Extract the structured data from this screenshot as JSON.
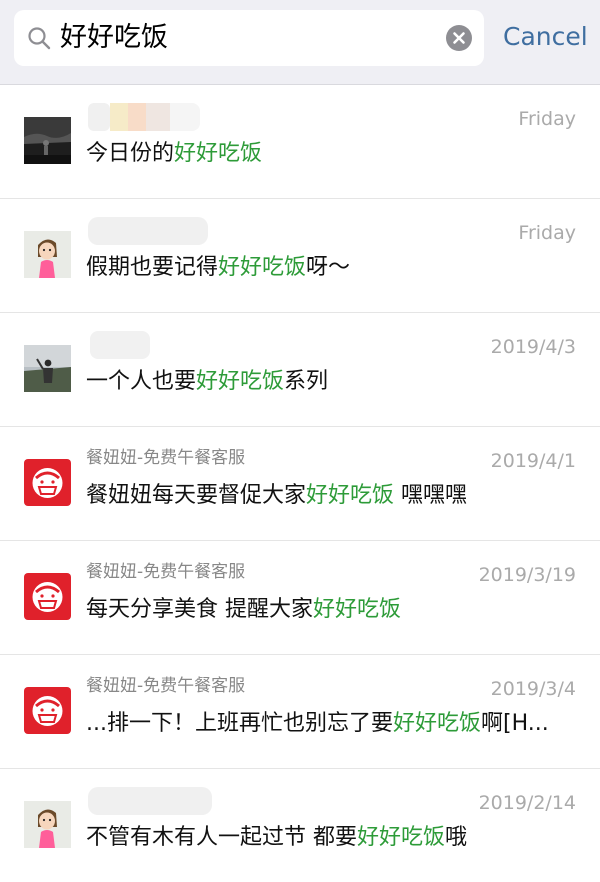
{
  "search": {
    "query": "好好吃饭",
    "cancel_label": "Cancel"
  },
  "results": [
    {
      "name": "",
      "date": "Friday",
      "pre": "今日份的",
      "hl": "好好吃饭",
      "post": "",
      "avatar": "dark-photo"
    },
    {
      "name": "",
      "date": "Friday",
      "pre": "假期也要记得",
      "hl": "好好吃饭",
      "post": "呀～",
      "avatar": "girl-cartoon"
    },
    {
      "name": "",
      "date": "2019/4/3",
      "pre": "一个人也要",
      "hl": "好好吃饭",
      "post": "系列",
      "avatar": "person-photo"
    },
    {
      "name": "餐妞妞-免费午餐客服",
      "date": "2019/4/1",
      "pre": "餐妞妞每天要督促大家",
      "hl": "好好吃饭",
      "post": " 嘿嘿嘿",
      "avatar": "red-logo"
    },
    {
      "name": "餐妞妞-免费午餐客服",
      "date": "2019/3/19",
      "pre": "每天分享美食  提醒大家",
      "hl": "好好吃饭",
      "post": "",
      "avatar": "red-logo"
    },
    {
      "name": "餐妞妞-免费午餐客服",
      "date": "2019/3/4",
      "pre": "...排一下！上班再忙也别忘了要",
      "hl": "好好吃饭",
      "post": "啊[H...",
      "avatar": "red-logo"
    },
    {
      "name": "",
      "date": "2019/2/14",
      "pre": "不管有木有人一起过节 都要",
      "hl": "好好吃饭",
      "post": "哦",
      "avatar": "girl-cartoon"
    }
  ],
  "colors": {
    "highlight": "#2d9b38",
    "cancel": "#3f6ea0",
    "header_bg": "#efeff4",
    "date": "#aaaaaa"
  }
}
